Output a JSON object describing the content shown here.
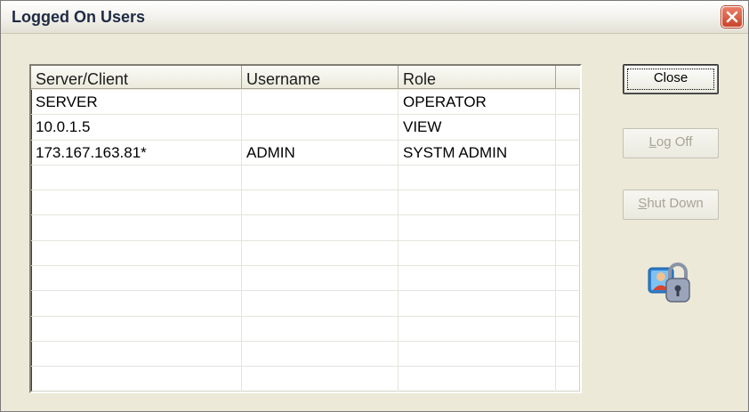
{
  "window": {
    "title": "Logged On Users"
  },
  "table": {
    "columns": [
      "Server/Client",
      "Username",
      "Role"
    ],
    "rows": [
      [
        "SERVER",
        "",
        "OPERATOR"
      ],
      [
        "10.0.1.5",
        "",
        "VIEW"
      ],
      [
        "173.167.163.81*",
        "ADMIN",
        "SYSTM ADMIN"
      ],
      [
        "",
        "",
        ""
      ],
      [
        "",
        "",
        ""
      ],
      [
        "",
        "",
        ""
      ],
      [
        "",
        "",
        ""
      ],
      [
        "",
        "",
        ""
      ],
      [
        "",
        "",
        ""
      ],
      [
        "",
        "",
        ""
      ],
      [
        "",
        "",
        ""
      ],
      [
        "",
        "",
        ""
      ]
    ]
  },
  "buttons": {
    "close": "Close",
    "log_off": {
      "underline": "L",
      "rest": "og Off"
    },
    "shut_down": {
      "underline": "S",
      "rest": "hut Down"
    }
  },
  "icons": {
    "title_close": "close-icon",
    "lock": "user-lock-icon"
  },
  "colors": {
    "title_close_bg": "#d4573d",
    "disabled_text": "#a7a596"
  }
}
